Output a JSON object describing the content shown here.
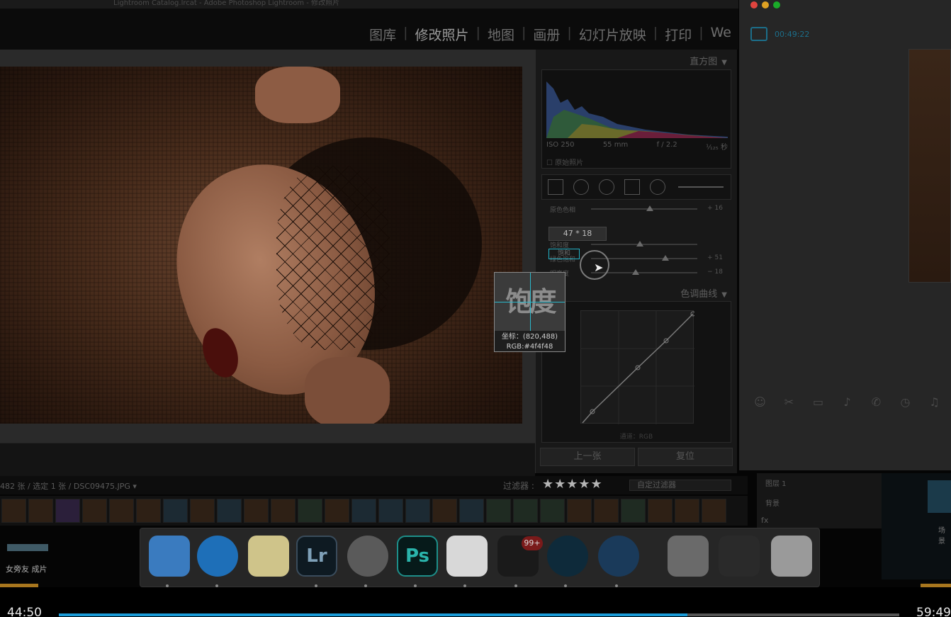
{
  "window": {
    "title": "Lightroom Catalog.lrcat - Adobe Photoshop Lightroom - 修改照片"
  },
  "modules": {
    "items": [
      "图库",
      "修改照片",
      "地图",
      "画册",
      "幻灯片放映",
      "打印",
      "We"
    ],
    "active_index": 1
  },
  "histogram": {
    "title": "直方图",
    "iso": "ISO 250",
    "focal": "55 mm",
    "aperture": "f / 2.2",
    "shutter": "¹⁄₁₂₅ 秒",
    "original_label": "原始照片"
  },
  "hsl": {
    "tooltip": "47 * 18",
    "rows": [
      {
        "label": "原色色相",
        "value": "+ 16",
        "pos": 0.55
      },
      {
        "label": "饱和度",
        "value": "",
        "pos": 0.46
      },
      {
        "label": "绿色饱和",
        "value": "+ 51",
        "pos": 0.7
      },
      {
        "label": "明亮度",
        "value": "− 18",
        "pos": 0.42
      }
    ],
    "selected_label": "饱和"
  },
  "tone_curve": {
    "title": "色调曲线",
    "channel": "通道：RGB"
  },
  "buttons": {
    "prev": "上一张",
    "reset": "复位"
  },
  "loupe": {
    "preview_text": "饱度",
    "coord": "坐标：(820,488)",
    "rgb": "RGB:#4f4f48"
  },
  "filmstrip": {
    "path": "482 张 / 选定 1 张 / DSC09475.JPG ▾",
    "filter_label": "过滤器 :",
    "stars": "★★★★★",
    "custom_filter": "自定过滤器"
  },
  "chat": {
    "time": "00:49:22",
    "dot_colors": [
      "#e0443e",
      "#dea123",
      "#1aab29"
    ]
  },
  "layers": {
    "row1": "图层 1",
    "row2": "背景",
    "row3": "fx"
  },
  "desktop": {
    "folder_name": "场景"
  },
  "left_caption": "女旁友 成片",
  "dock": {
    "qq_badge": "99+",
    "apps": [
      "finder-icon",
      "safari-icon",
      "notes-icon",
      "lightroom-icon",
      "system-preferences-icon",
      "photoshop-icon",
      "baidu-netdisk-icon",
      "qq-icon",
      "screen-share-icon",
      "quicktime-icon",
      "preview-stack-icon",
      "screenshot-stack-icon",
      "trash-icon"
    ]
  },
  "video": {
    "elapsed": "44:50",
    "total": "59:49",
    "progress": 0.748
  }
}
